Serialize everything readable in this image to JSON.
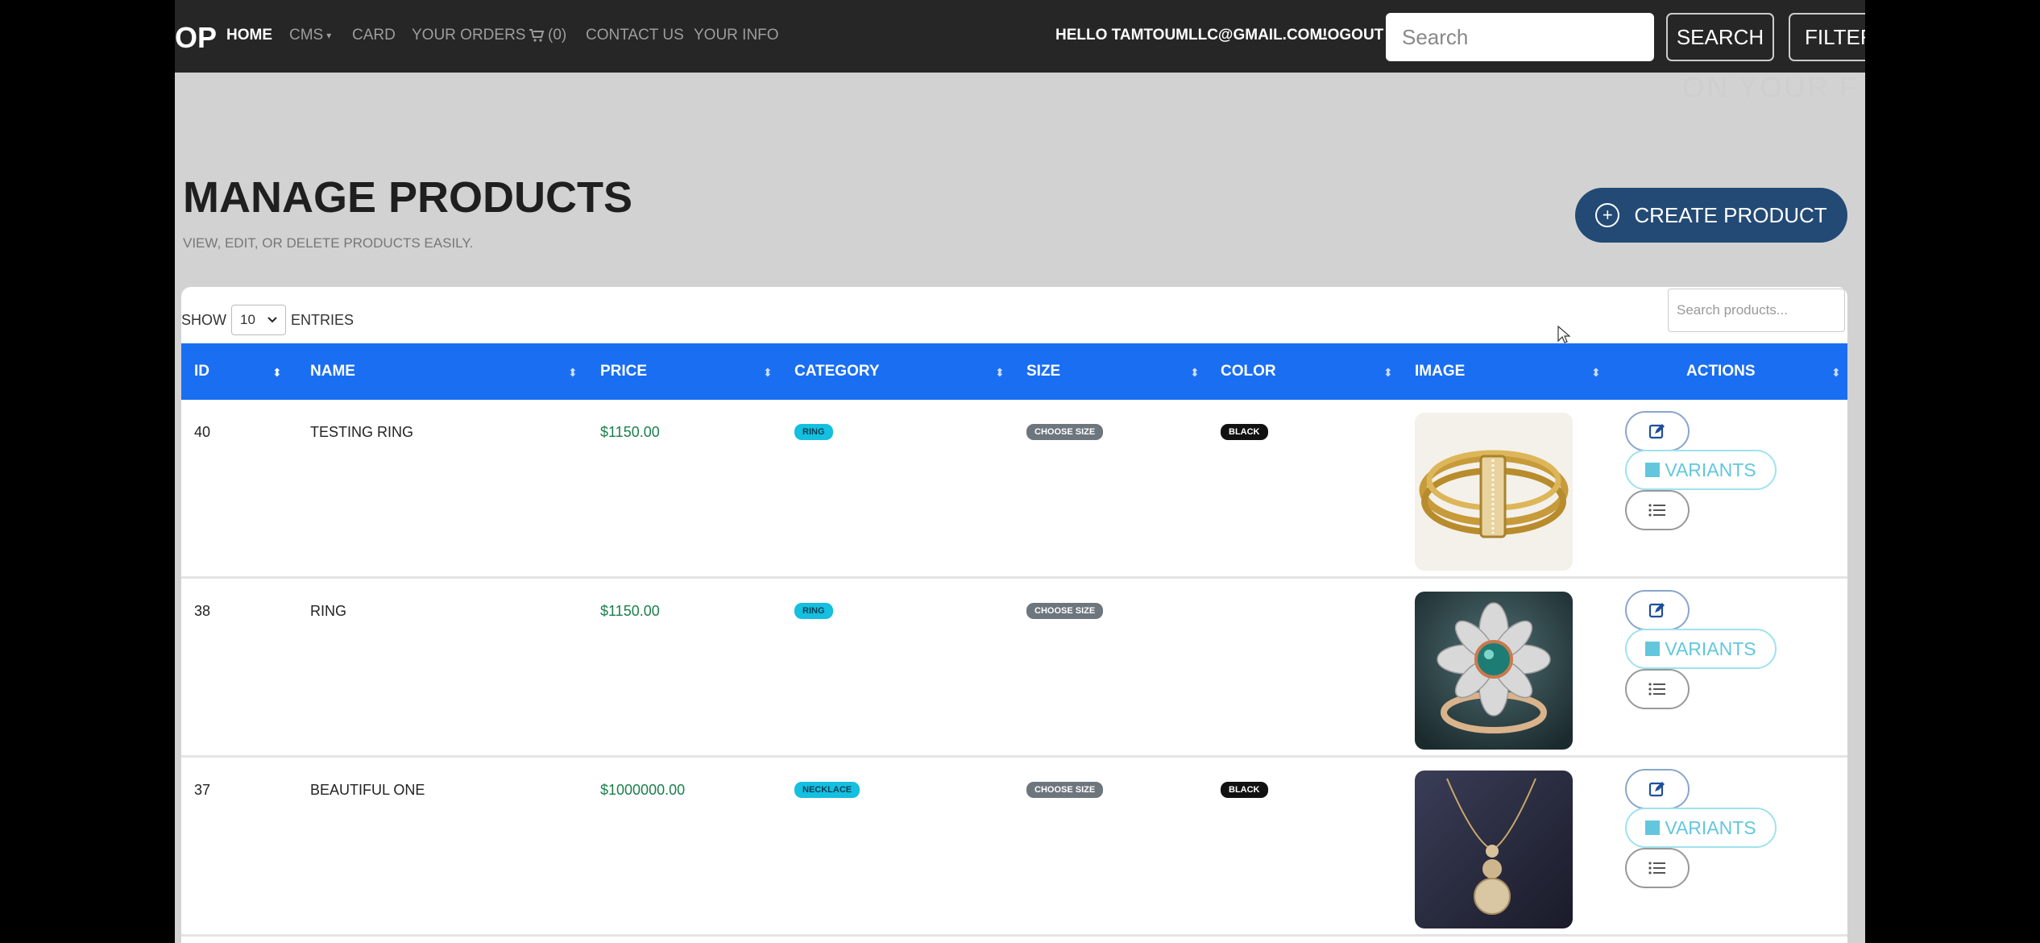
{
  "nav": {
    "brand": "OP",
    "items": [
      "HOME",
      "CMS",
      "CARD",
      "YOUR ORDERS",
      "(0)",
      "CONTACT US",
      "YOUR INFO"
    ],
    "greeting": "HELLO TAMTOUMLLC@GMAIL.COM!",
    "logout": "LOGOUT",
    "search_placeholder": "Search",
    "search_button": "SEARCH",
    "filter_button": "FILTER"
  },
  "watermark": "ON YOUR F",
  "header": {
    "title": "MANAGE PRODUCTS",
    "subtitle": "VIEW, EDIT, OR DELETE PRODUCTS EASILY.",
    "create_button": "CREATE PRODUCT"
  },
  "table_controls": {
    "show": "SHOW",
    "entries_value": "10",
    "entries": "ENTRIES",
    "search_placeholder": "Search products..."
  },
  "columns": [
    "ID",
    "NAME",
    "PRICE",
    "CATEGORY",
    "SIZE",
    "COLOR",
    "IMAGE",
    "ACTIONS"
  ],
  "rows": [
    {
      "id": "40",
      "name": "TESTING RING",
      "price": "$1150.00",
      "category": "RING",
      "size": "CHOOSE SIZE",
      "color": "BLACK",
      "image": "gold-ring"
    },
    {
      "id": "38",
      "name": "RING",
      "price": "$1150.00",
      "category": "RING",
      "size": "CHOOSE SIZE",
      "color": "",
      "image": "flower-ring"
    },
    {
      "id": "37",
      "name": "BEAUTIFUL ONE",
      "price": "$1000000.00",
      "category": "NECKLACE",
      "size": "CHOOSE SIZE",
      "color": "BLACK",
      "image": "pendant-necklace"
    }
  ],
  "actions": {
    "variants_label": "VARIANTS"
  },
  "colors": {
    "navbar": "#262626",
    "table_header": "#1a6ef2",
    "create_button": "#234a75",
    "category_badge": "#14bfe0",
    "price": "#1a7f4b"
  }
}
